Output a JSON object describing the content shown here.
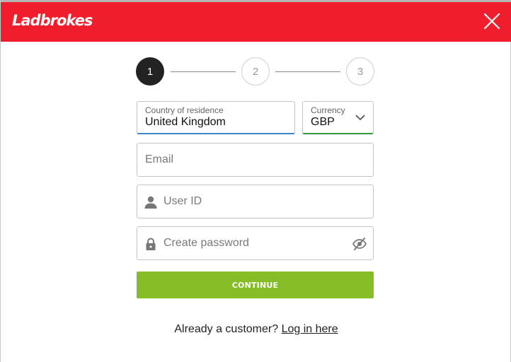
{
  "header": {
    "logo_text": "Ladbrokes",
    "brand_color": "#f01e2c",
    "close_icon": "close-icon"
  },
  "stepper": {
    "steps": [
      {
        "label": "1",
        "state": "active"
      },
      {
        "label": "2",
        "state": "inactive"
      },
      {
        "label": "3",
        "state": "inactive"
      }
    ]
  },
  "form": {
    "country": {
      "label": "Country of residence",
      "value": "United Kingdom"
    },
    "currency": {
      "label": "Currency",
      "value": "GBP",
      "icon": "chevron-down-icon"
    },
    "email": {
      "placeholder": "Email"
    },
    "userid": {
      "placeholder": "User ID",
      "icon": "user-icon"
    },
    "password": {
      "placeholder": "Create password",
      "icon": "lock-icon",
      "toggle_icon": "eye-off-icon"
    },
    "continue_label": "CONTINUE",
    "continue_color": "#86bc25"
  },
  "footer": {
    "prompt": "Already a customer?",
    "login_link": "Log in here"
  }
}
